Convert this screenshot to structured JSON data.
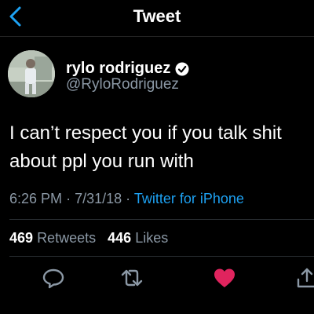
{
  "header": {
    "title": "Tweet"
  },
  "author": {
    "name": "rylo rodriguez",
    "handle": "@RyloRodriguez"
  },
  "tweet": {
    "text": "I can’t respect you if you talk shit about ppl you run with"
  },
  "meta": {
    "time": "6:26 PM",
    "date": "7/31/18",
    "source": "Twitter for iPhone"
  },
  "stats": {
    "retweets": "469",
    "retweets_label": "Retweets",
    "likes": "446",
    "likes_label": "Likes"
  },
  "icons": {
    "back": "chevron-left-icon",
    "verified": "verified-badge-icon",
    "reply": "reply-icon",
    "retweet": "retweet-icon",
    "like": "heart-icon",
    "share": "share-icon"
  },
  "colors": {
    "accent": "#1da1f2",
    "like": "#e0245e",
    "muted": "#8b98a5",
    "background": "#000000"
  }
}
